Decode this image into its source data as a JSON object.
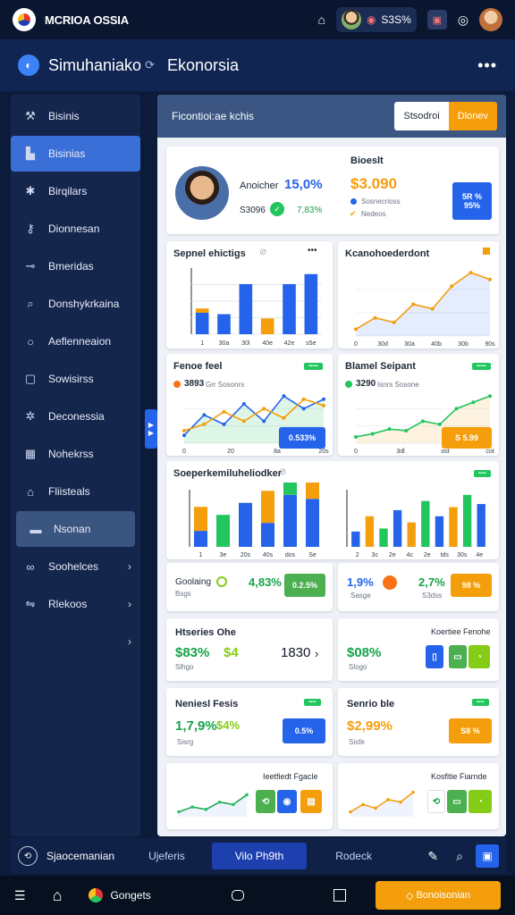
{
  "topbar": {
    "brand": "MCRIOA OSSIA",
    "counter": "S3S%"
  },
  "header": {
    "title": "Simuhaniako",
    "subtitle": "Ekonorsia"
  },
  "sidebar": {
    "items": [
      {
        "label": "Bisinis",
        "icon": "wrench-icon"
      },
      {
        "label": "Bisinias",
        "icon": "building-icon"
      },
      {
        "label": "Birqilars",
        "icon": "asterisk-icon"
      },
      {
        "label": "Dionnesan",
        "icon": "key-icon"
      },
      {
        "label": "Bmeridas",
        "icon": "link-icon"
      },
      {
        "label": "Donshykrkaina",
        "icon": "search-icon"
      },
      {
        "label": "Aeflenneaion",
        "icon": "circle-icon"
      },
      {
        "label": "Sowisirss",
        "icon": "square-icon"
      },
      {
        "label": "Deconessia",
        "icon": "compass-icon"
      },
      {
        "label": "Nohekrss",
        "icon": "grid-icon"
      },
      {
        "label": "Fliisteals",
        "icon": "home-icon"
      },
      {
        "label": "Nsonan",
        "icon": "card-icon"
      },
      {
        "label": "Soohelces",
        "icon": "infinity-icon"
      },
      {
        "label": "Rlekoos",
        "icon": "flow-icon"
      }
    ]
  },
  "main": {
    "heading": "Ficontioi:ae kchis",
    "btn1": "Stsodroi",
    "btn2": "Dlonev",
    "profile": {
      "name": "Anoicher",
      "value": "15,0%",
      "sub1": "S3096",
      "sub2": "7,83%",
      "title": "Bioeslt",
      "amount": "$3.090",
      "line1": "Sosnecrioss",
      "line2": "Nedeos",
      "badge1": "5R %",
      "badge2": "95%"
    },
    "c1": {
      "title": "Sepnel ehictigs",
      "more": "•••"
    },
    "c2": {
      "title": "Kcanohoederdont"
    },
    "c3": {
      "title": "Fenoe feel",
      "stat": "3893",
      "statlabel": "Grr Sosonrs",
      "tag": "0.533%",
      "badge": "▪▪▪▪▪"
    },
    "c4": {
      "title": "Blamel Seipant",
      "stat": "3290",
      "statlabel": "Isnrs Sosone",
      "tag": "S 5.99",
      "badge": "▪▪▪▪▪"
    },
    "c5": {
      "title": "Soeperkemiluheliodker",
      "badge": "▪▪▪▪"
    },
    "r1": {
      "a_label": "Goolaing",
      "a_val": "4,83%",
      "a_sub": "Bsgs",
      "a_pill": "0.2.5%",
      "b_val": "1,9%",
      "b_sub": "Sasge",
      "b_val2": "2,7%",
      "b_sub2": "S3dss",
      "b_pill": "98 %"
    },
    "r2": {
      "title": "Htseries Ohe",
      "v1": "$83%",
      "v2": "$4",
      "v3": "1830",
      "sub": "Slhgo",
      "b_title": "Koertiee Fenohe",
      "b_val": "$08%",
      "b_sub": "Slogo"
    },
    "r3": {
      "title": "Neniesl Fesis",
      "v1": "1,7,9%",
      "v2": "$4%",
      "sub": "Sisrg",
      "pill": "0.5%",
      "b_title": "Senrio ble",
      "b_val": "$2,99%",
      "b_sub": "Sisfe",
      "b_pill": "S8 %"
    },
    "r4": {
      "a_title": "Ieetfiedt Fgacle",
      "b_title": "Kosfitie Fiarnde"
    }
  },
  "chart_data": [
    {
      "type": "bar",
      "title": "Sepnel ehictigs",
      "series": [
        {
          "name": "",
          "values": [
            15,
            14,
            35,
            11,
            35,
            42
          ]
        },
        {
          "name": "",
          "values": [
            3,
            0,
            0,
            0,
            0,
            0
          ]
        }
      ],
      "categories": [
        "1",
        "30a",
        "30l",
        "40e",
        "42e",
        "s5e"
      ]
    },
    {
      "type": "line",
      "title": "Kcanohoederdont",
      "series": [
        {
          "name": "",
          "values": [
            3,
            8,
            6,
            14,
            12,
            22,
            28,
            25
          ]
        }
      ],
      "categories": [
        "0",
        "30d",
        "30a",
        "40b",
        "30b",
        "90s"
      ]
    },
    {
      "type": "line",
      "title": "Fenoe feel",
      "series": [
        {
          "name": "",
          "values": [
            5,
            18,
            12,
            25,
            14,
            30,
            22,
            28
          ]
        },
        {
          "name": "",
          "values": [
            8,
            12,
            20,
            14,
            22,
            16,
            28,
            24
          ]
        }
      ],
      "categories": [
        "0",
        "20",
        "8a",
        "20s"
      ]
    },
    {
      "type": "line",
      "title": "Blamel Seipant",
      "series": [
        {
          "name": "",
          "values": [
            4,
            6,
            9,
            8,
            14,
            12,
            22,
            26,
            30
          ]
        }
      ],
      "categories": [
        "0",
        "3dl",
        "ost",
        "cot"
      ]
    },
    {
      "type": "bar",
      "title": "Soeperkemiluheliodker",
      "series": [
        {
          "name": "",
          "values": [
            8,
            16,
            22,
            12,
            26,
            24
          ]
        },
        {
          "name": "",
          "values": [
            12,
            0,
            0,
            16,
            14,
            26
          ]
        }
      ],
      "categories": [
        "1",
        "3e",
        "20s",
        "40s",
        "dos",
        "Se"
      ]
    },
    {
      "type": "bar",
      "title": "",
      "series": [
        {
          "name": "",
          "values": [
            10,
            20,
            12,
            24,
            16,
            30,
            20,
            26,
            34,
            28
          ]
        }
      ],
      "categories": [
        "2",
        "3c",
        "2e",
        "4c",
        "2e",
        "tds",
        "30s",
        "4e"
      ]
    }
  ],
  "bottomnav": {
    "left": "Sjaocemanian",
    "mid": "Ujeferis",
    "active": "Vilo Ph9th",
    "right": "Rodeck"
  },
  "sysbar": {
    "label": "Gongets",
    "cta": "Bonoisonian"
  }
}
